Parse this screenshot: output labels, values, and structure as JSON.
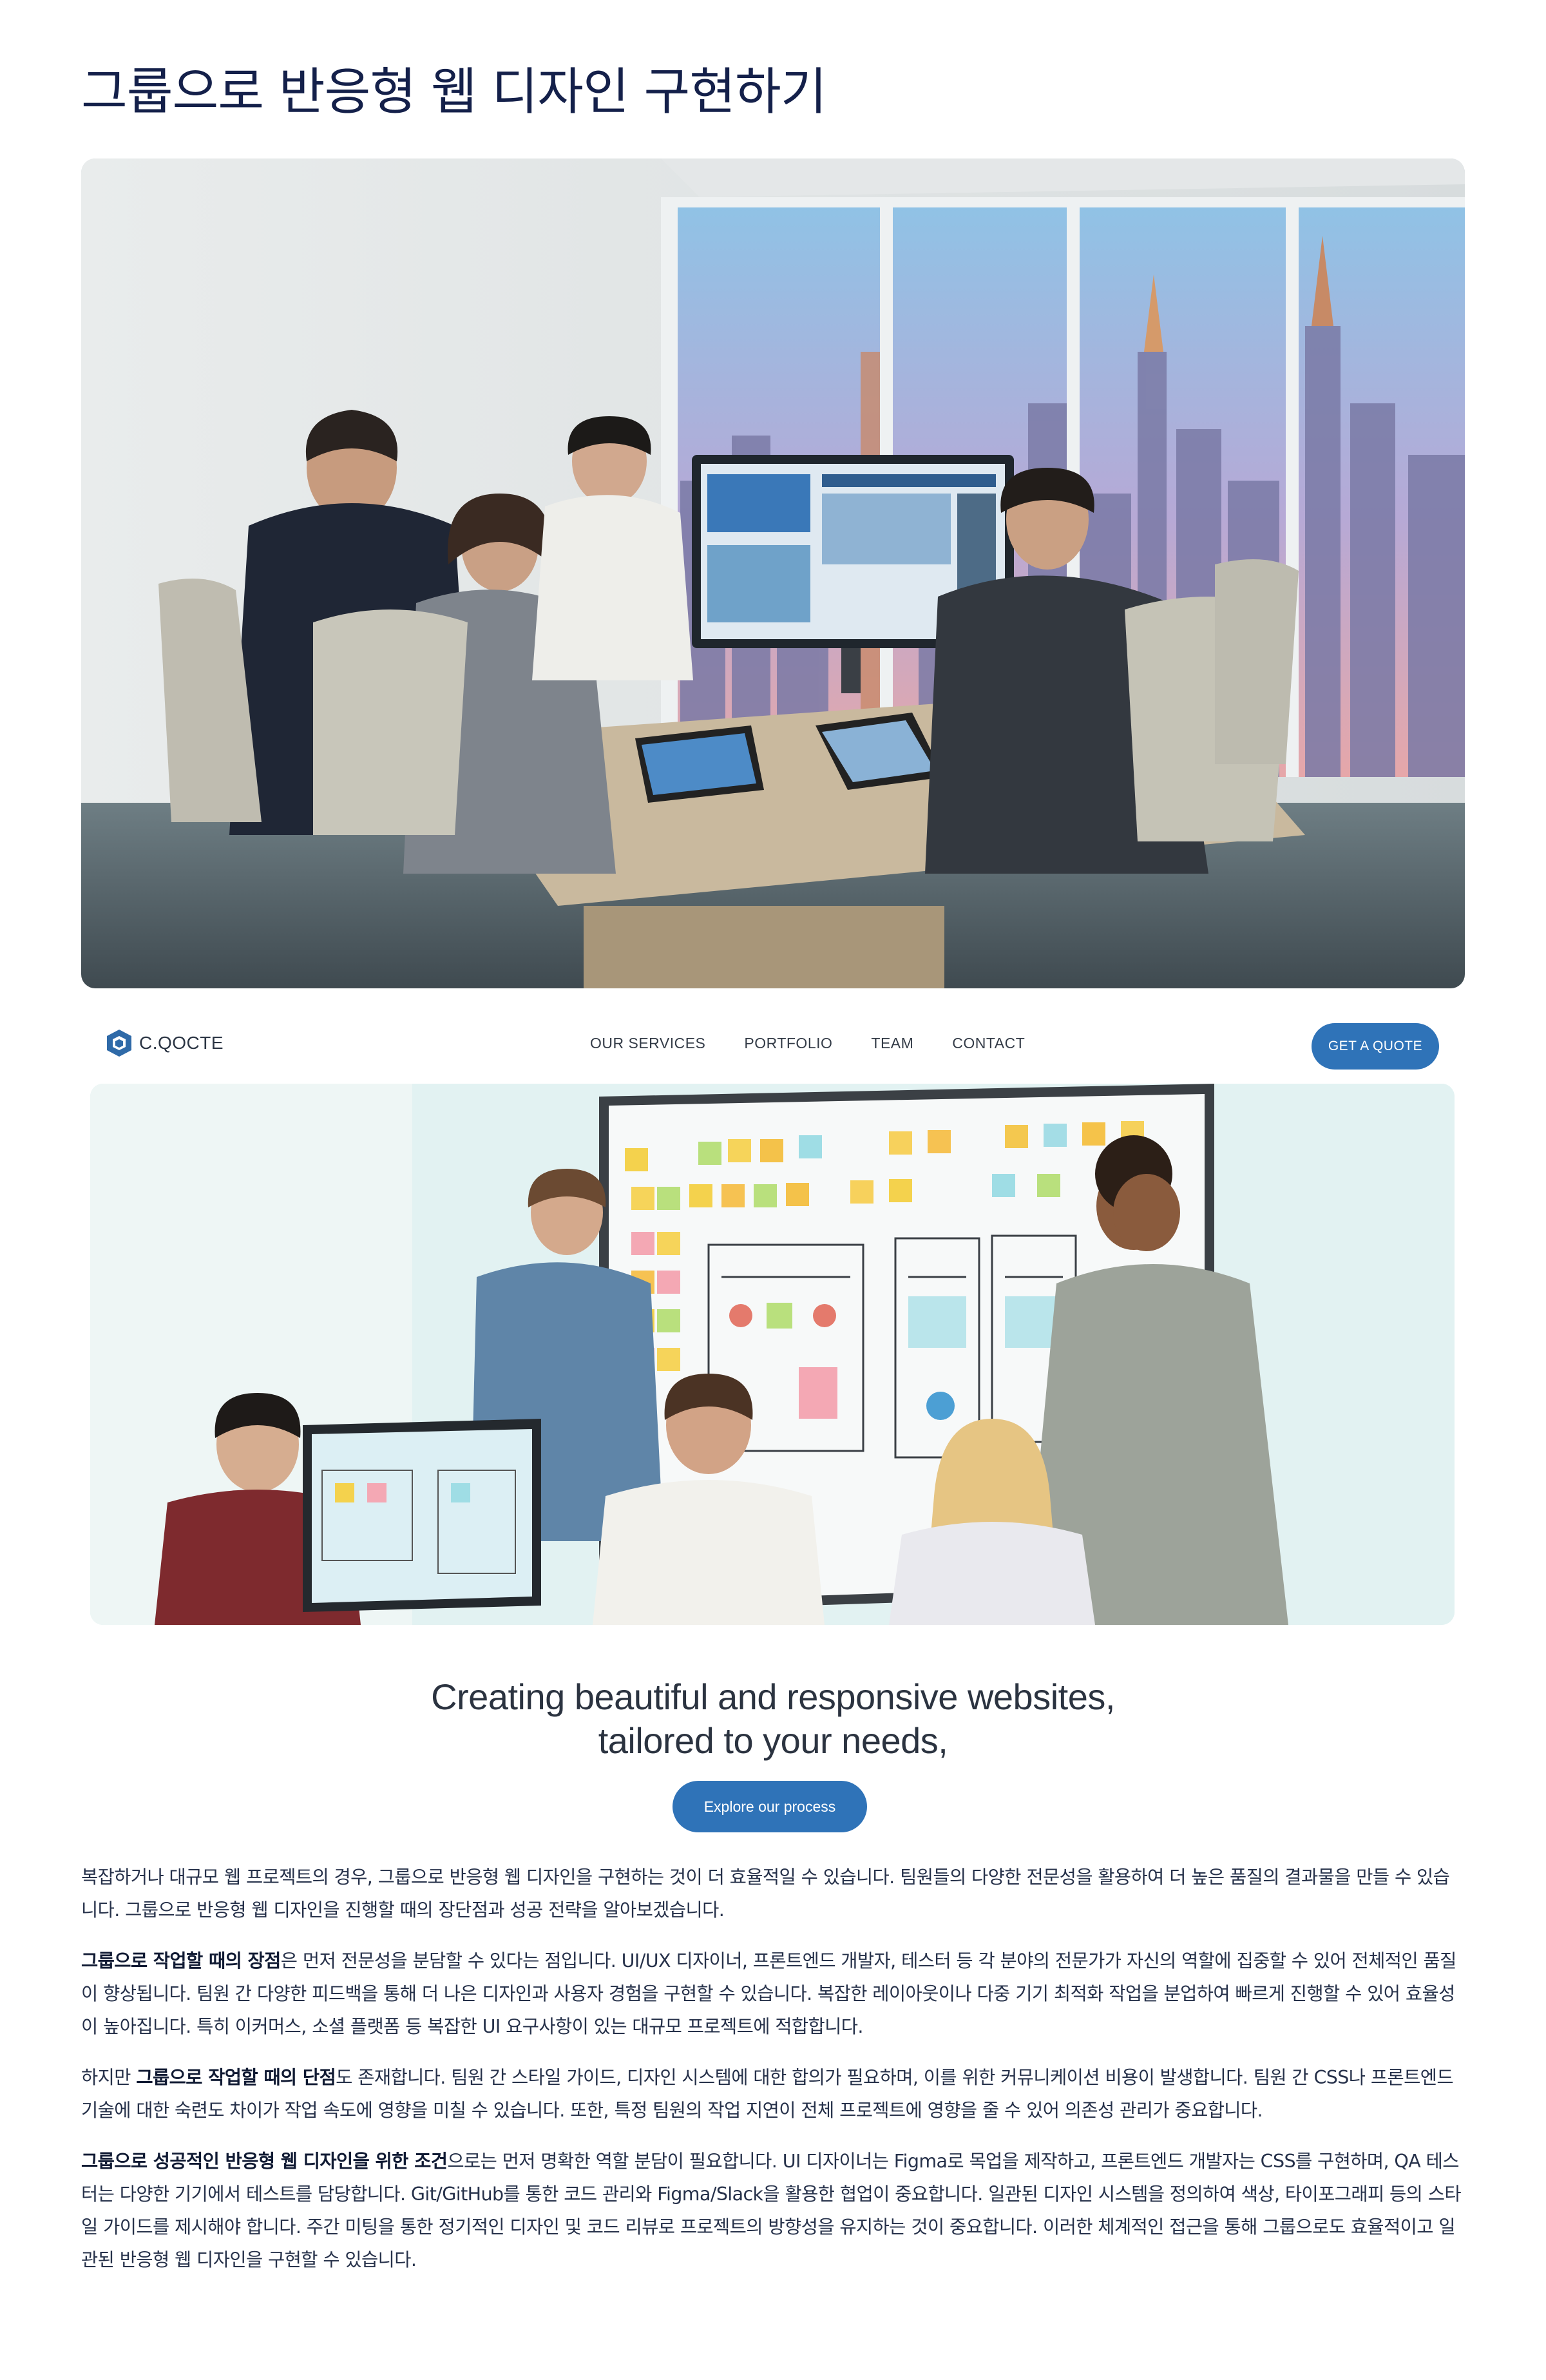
{
  "page": {
    "title": "그룹으로 반응형 웹 디자인 구현하기"
  },
  "site": {
    "brand": "C.QOCTE",
    "nav": [
      "OUR SERVICES",
      "PORTFOLIO",
      "TEAM",
      "CONTACT"
    ],
    "quote_button": "GET A QUOTE",
    "hero_line1": "Creating beautiful and responsive websites,",
    "hero_line2": "tailored to your needs,",
    "cta_button": "Explore our process",
    "accent": "#2f73b8"
  },
  "article": {
    "p1": "복잡하거나 대규모 웹 프로젝트의 경우, 그룹으로 반응형 웹 디자인을 구현하는 것이 더 효율적일 수 있습니다. 팀원들의 다양한 전문성을 활용하여 더 높은 품질의 결과물을 만들 수 있습니다. 그룹으로 반응형 웹 디자인을 진행할 때의 장단점과 성공 전략을 알아보겠습니다.",
    "p2_bold": "그룹으로 작업할 때의 장점",
    "p2": "은 먼저 전문성을 분담할 수 있다는 점입니다. UI/UX 디자이너, 프론트엔드 개발자, 테스터 등 각 분야의 전문가가 자신의 역할에 집중할 수 있어 전체적인 품질이 향상됩니다. 팀원 간 다양한 피드백을 통해 더 나은 디자인과 사용자 경험을 구현할 수 있습니다. 복잡한 레이아웃이나 다중 기기 최적화 작업을 분업하여 빠르게 진행할 수 있어 효율성이 높아집니다. 특히 이커머스, 소셜 플랫폼 등 복잡한 UI 요구사항이 있는 대규모 프로젝트에 적합합니다.",
    "p3_pre": "하지만 ",
    "p3_bold": "그룹으로 작업할 때의 단점",
    "p3": "도 존재합니다. 팀원 간 스타일 가이드, 디자인 시스템에 대한 합의가 필요하며, 이를 위한 커뮤니케이션 비용이 발생합니다. 팀원 간 CSS나 프론트엔드 기술에 대한 숙련도 차이가 작업 속도에 영향을 미칠 수 있습니다. 또한, 특정 팀원의 작업 지연이 전체 프로젝트에 영향을 줄 수 있어 의존성 관리가 중요합니다.",
    "p4_bold": "그룹으로 성공적인 반응형 웹 디자인을 위한 조건",
    "p4": "으로는 먼저 명확한 역할 분담이 필요합니다. UI 디자이너는 Figma로 목업을 제작하고, 프론트엔드 개발자는 CSS를 구현하며, QA 테스터는 다양한 기기에서 테스트를 담당합니다. Git/GitHub를 통한 코드 관리와 Figma/Slack을 활용한 협업이 중요합니다. 일관된 디자인 시스템을 정의하여 색상, 타이포그래피 등의 스타일 가이드를 제시해야 합니다. 주간 미팅을 통한 정기적인 디자인 및 코드 리뷰로 프로젝트의 방향성을 유지하는 것이 중요합니다. 이러한 체계적인 접근을 통해 그룹으로도 효율적이고 일관된 반응형 웹 디자인을 구현할 수 있습니다."
  }
}
